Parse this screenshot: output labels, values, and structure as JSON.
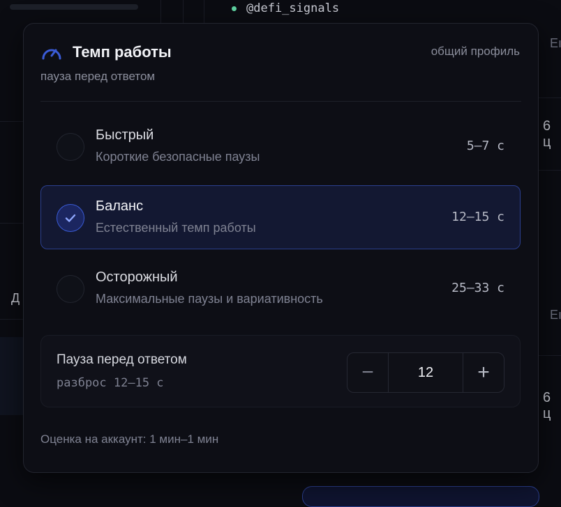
{
  "background": {
    "channel": "@defi_signals",
    "right_labels": [
      "Eı",
      "6 ц",
      "Eı",
      "6 ц"
    ],
    "left_label": "Д"
  },
  "popover": {
    "title": "Темп работы",
    "profile": "общий профиль",
    "subtitle": "пауза перед ответом",
    "icon": "speedometer-icon",
    "options": [
      {
        "name": "Быстрый",
        "desc": "Короткие безопасные паузы",
        "range": "5–7 с",
        "selected": false
      },
      {
        "name": "Баланс",
        "desc": "Естественный темп работы",
        "range": "12–15 с",
        "selected": true
      },
      {
        "name": "Осторожный",
        "desc": "Максимальные паузы и вариативность",
        "range": "25–33 с",
        "selected": false
      }
    ],
    "pause": {
      "label": "Пауза перед ответом",
      "spread": "разброс 12–15 с",
      "value": "12",
      "minus": "−",
      "plus": "+"
    },
    "estimate": "Оценка на аккаунт: 1 мин–1 мин"
  },
  "colors": {
    "accent": "#3a5bd6",
    "selected_bg": "#131832",
    "status_dot": "#5fd3a2"
  }
}
